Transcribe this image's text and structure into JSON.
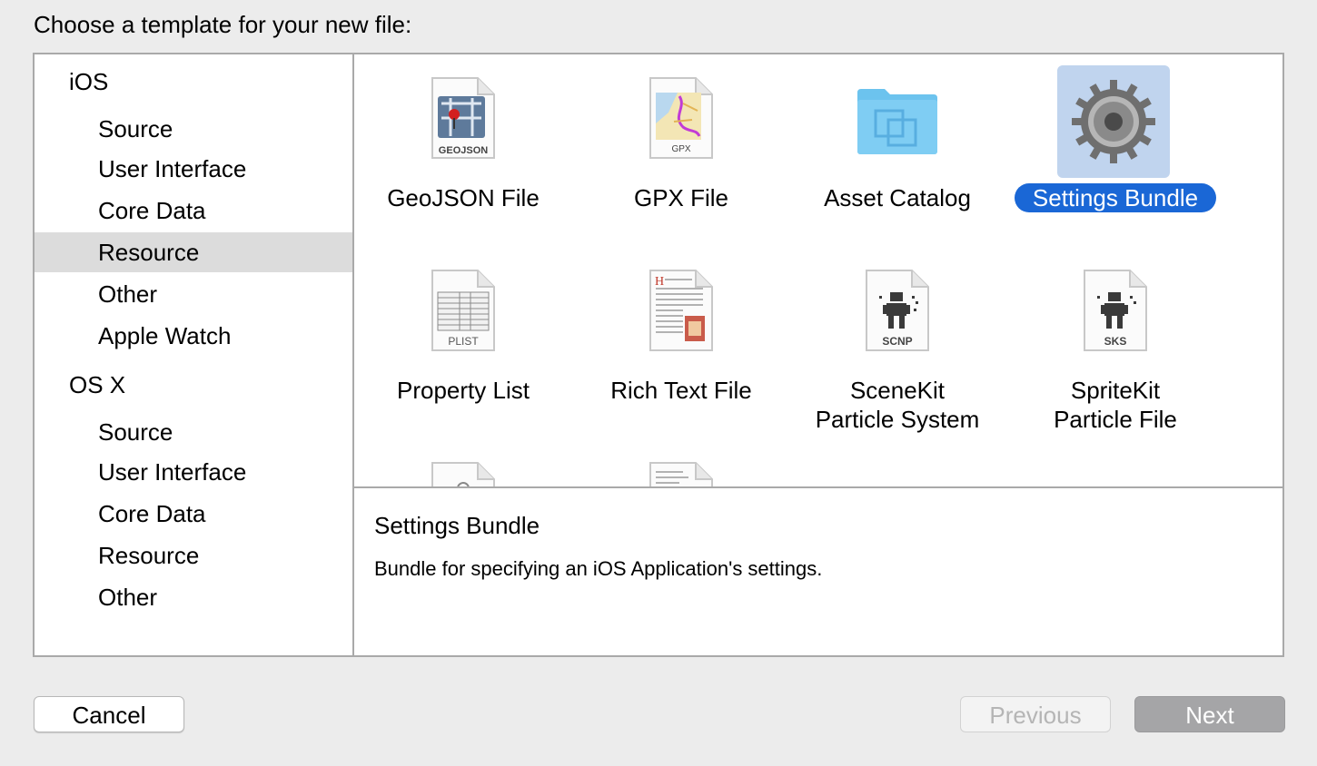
{
  "dialog": {
    "title": "Choose a template for your new file:"
  },
  "sidebar": {
    "groups": [
      {
        "label": "iOS",
        "items": [
          {
            "label": "Source"
          },
          {
            "label": "User Interface"
          },
          {
            "label": "Core Data"
          },
          {
            "label": "Resource",
            "selected": true
          },
          {
            "label": "Other"
          },
          {
            "label": "Apple Watch"
          }
        ]
      },
      {
        "label": "OS X",
        "items": [
          {
            "label": "Source"
          },
          {
            "label": "User Interface"
          },
          {
            "label": "Core Data"
          },
          {
            "label": "Resource"
          },
          {
            "label": "Other"
          }
        ]
      }
    ]
  },
  "templates": [
    {
      "label": "GeoJSON File",
      "badge": "GEOJSON",
      "icon": "geojson-file-icon"
    },
    {
      "label": "GPX File",
      "badge": "GPX",
      "icon": "gpx-file-icon"
    },
    {
      "label": "Asset Catalog",
      "icon": "asset-catalog-folder-icon"
    },
    {
      "label": "Settings Bundle",
      "icon": "gear-icon",
      "selected": true
    },
    {
      "label": "Property List",
      "badge": "PLIST",
      "icon": "plist-file-icon"
    },
    {
      "label": "Rich Text File",
      "icon": "rich-text-file-icon"
    },
    {
      "label_line1": "SceneKit",
      "label_line2": "Particle System",
      "badge": "SCNP",
      "icon": "scenekit-particle-icon"
    },
    {
      "label_line1": "SpriteKit",
      "label_line2": "Particle File",
      "badge": "SKS",
      "icon": "spritekit-particle-icon"
    }
  ],
  "description": {
    "title": "Settings Bundle",
    "text": "Bundle for specifying an iOS Application's settings."
  },
  "buttons": {
    "cancel": "Cancel",
    "previous": "Previous",
    "next": "Next"
  },
  "colors": {
    "selection": "#1a67d6",
    "icon_highlight": "#c0d4ee",
    "sidebar_selected": "#dcdcdc"
  }
}
